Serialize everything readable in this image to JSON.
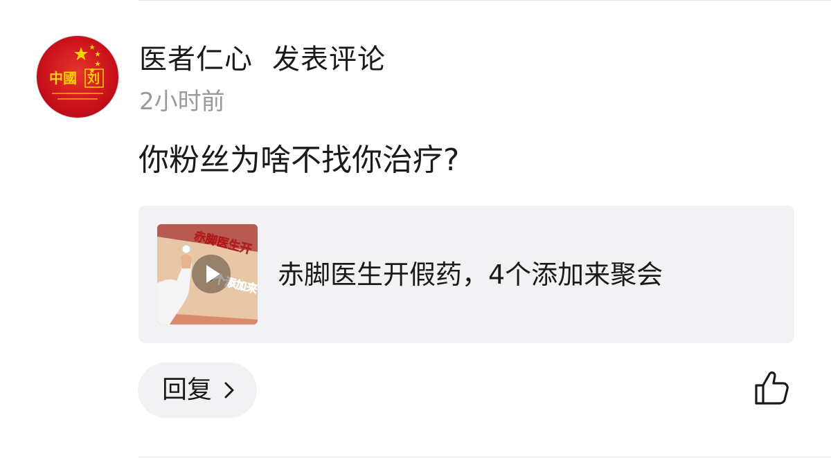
{
  "comment": {
    "author": "医者仁心",
    "action": "发表评论",
    "time": "2小时前",
    "text": "你粉丝为啥不找你治疗?",
    "avatar_icon": "china-flag-avatar-icon",
    "avatar_texts": [
      "中國",
      "刘"
    ]
  },
  "video_card": {
    "title": "赤脚医生开假药，4个添加来聚会",
    "thumbnail_icon": "video-thumbnail",
    "play_icon": "play-icon",
    "thumbnail_texts": [
      "赤脚医生开",
      "4个添加来"
    ]
  },
  "actions": {
    "reply_label": "回复",
    "reply_icon": "chevron-right-icon",
    "like_icon": "thumbs-up-icon"
  },
  "colors": {
    "text_primary": "#1a1a1a",
    "text_secondary": "#9a9a9a",
    "card_bg": "#f2f2f4",
    "avatar_red": "#c8101a"
  }
}
